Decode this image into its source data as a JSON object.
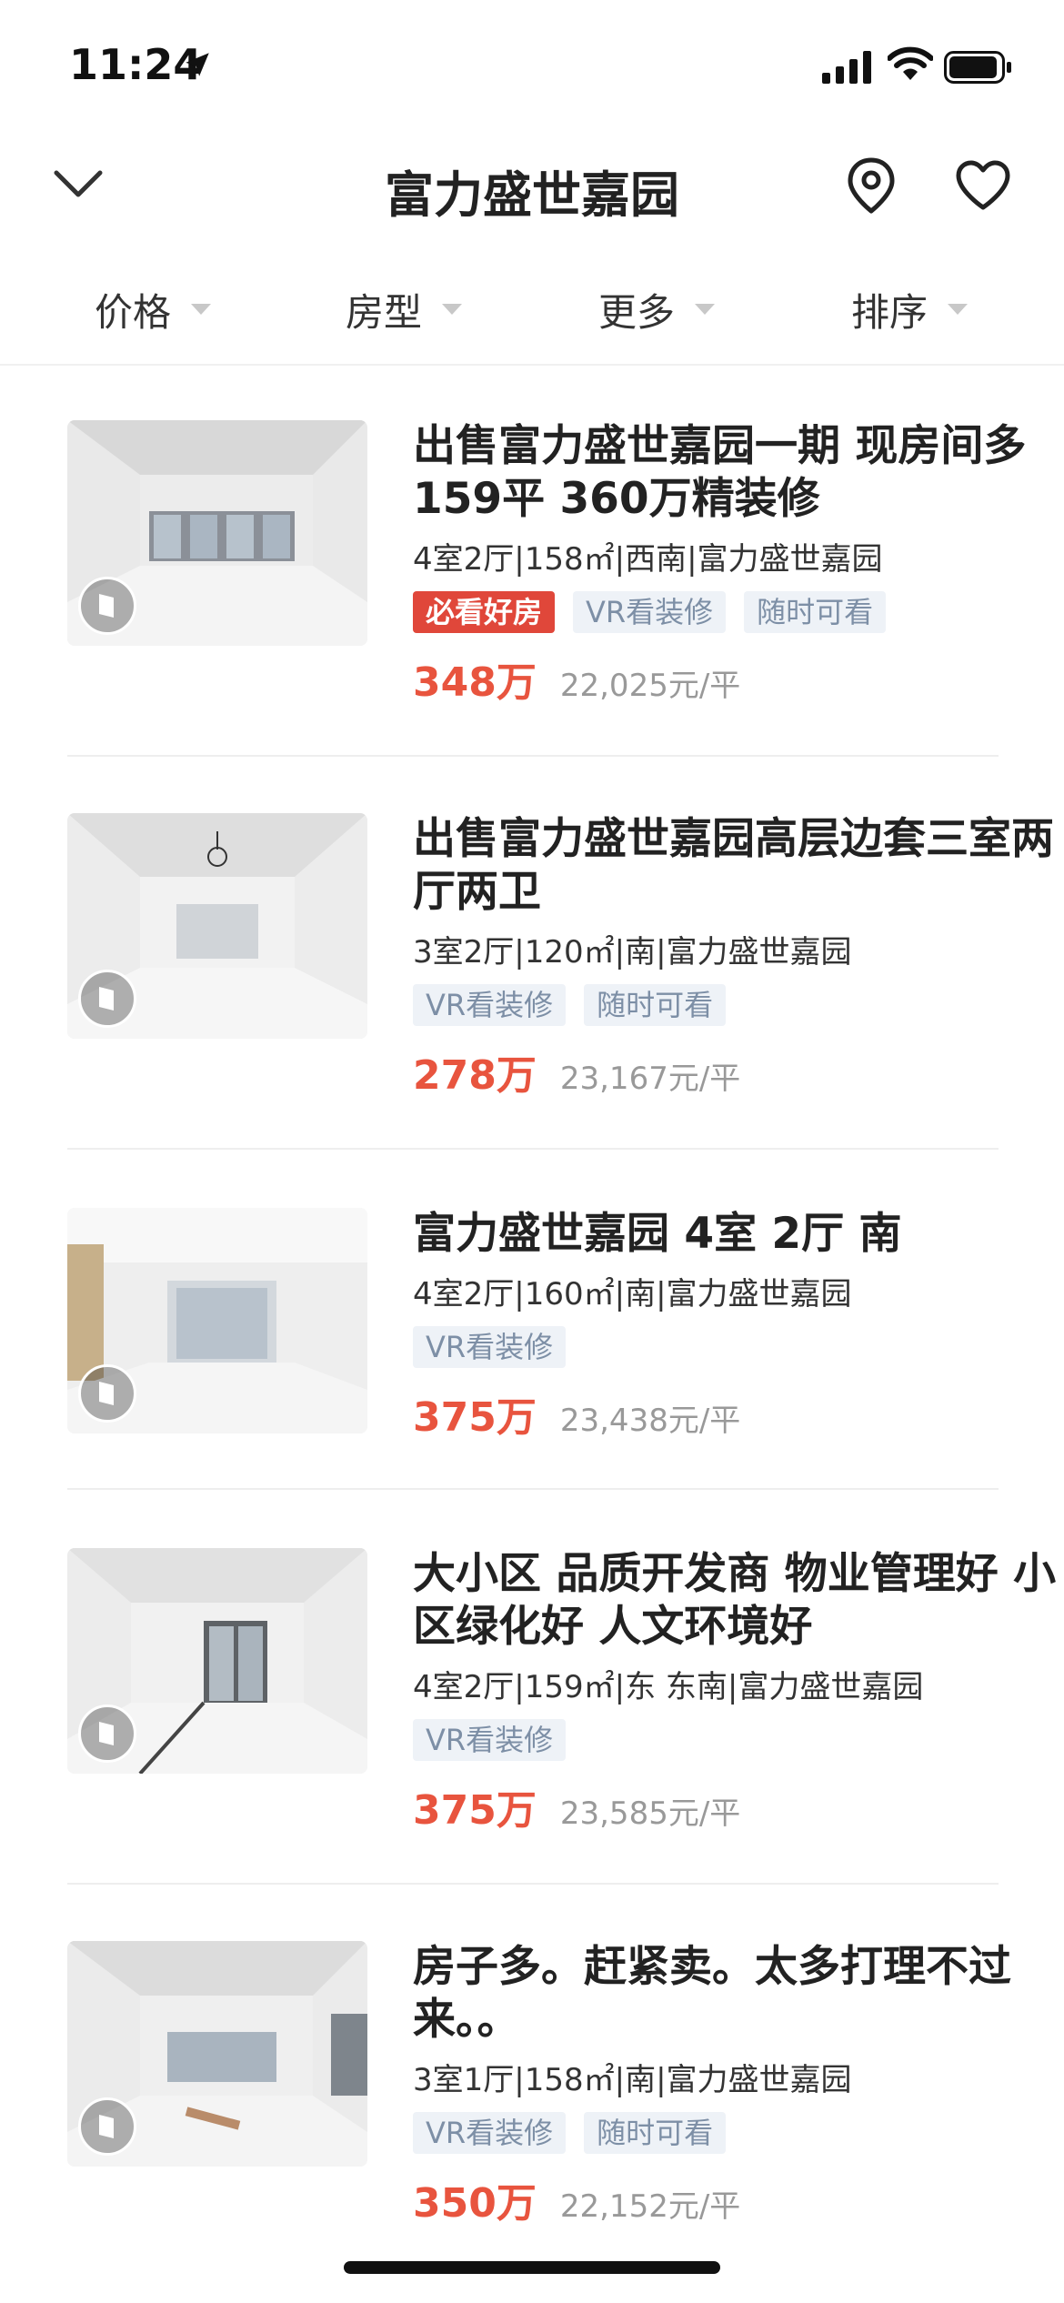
{
  "status_bar": {
    "time": "11:24"
  },
  "header": {
    "title": "富力盛世嘉园"
  },
  "filters": [
    {
      "label": "价格"
    },
    {
      "label": "房型"
    },
    {
      "label": "更多"
    },
    {
      "label": "排序"
    }
  ],
  "listings": [
    {
      "title": "出售富力盛世嘉园一期 现房间多159平 360万精装修",
      "meta": "4室2厅|158㎡|西南|富力盛世嘉园",
      "tags": [
        "必看好房",
        "VR看装修",
        "随时可看"
      ],
      "price": "348万",
      "unit_price": "22,025元/平"
    },
    {
      "title": "出售富力盛世嘉园高层边套三室两厅两卫",
      "meta": "3室2厅|120㎡|南|富力盛世嘉园",
      "tags": [
        "VR看装修",
        "随时可看"
      ],
      "price": "278万",
      "unit_price": "23,167元/平"
    },
    {
      "title": "富力盛世嘉园 4室 2厅 南",
      "meta": "4室2厅|160㎡|南|富力盛世嘉园",
      "tags": [
        "VR看装修"
      ],
      "price": "375万",
      "unit_price": "23,438元/平"
    },
    {
      "title": "大小区 品质开发商 物业管理好 小区绿化好 人文环境好",
      "meta": "4室2厅|159㎡|东 东南|富力盛世嘉园",
      "tags": [
        "VR看装修"
      ],
      "price": "375万",
      "unit_price": "23,585元/平"
    },
    {
      "title": "房子多。赶紧卖。太多打理不过来。。",
      "meta": "3室1厅|158㎡|南|富力盛世嘉园",
      "tags": [
        "VR看装修",
        "随时可看"
      ],
      "price": "350万",
      "unit_price": "22,152元/平"
    }
  ],
  "colors": {
    "price": "#e8543e",
    "hot_tag": "#e0473a",
    "tag_bg": "#eef2f7",
    "tag_text": "#7d8fa6"
  }
}
